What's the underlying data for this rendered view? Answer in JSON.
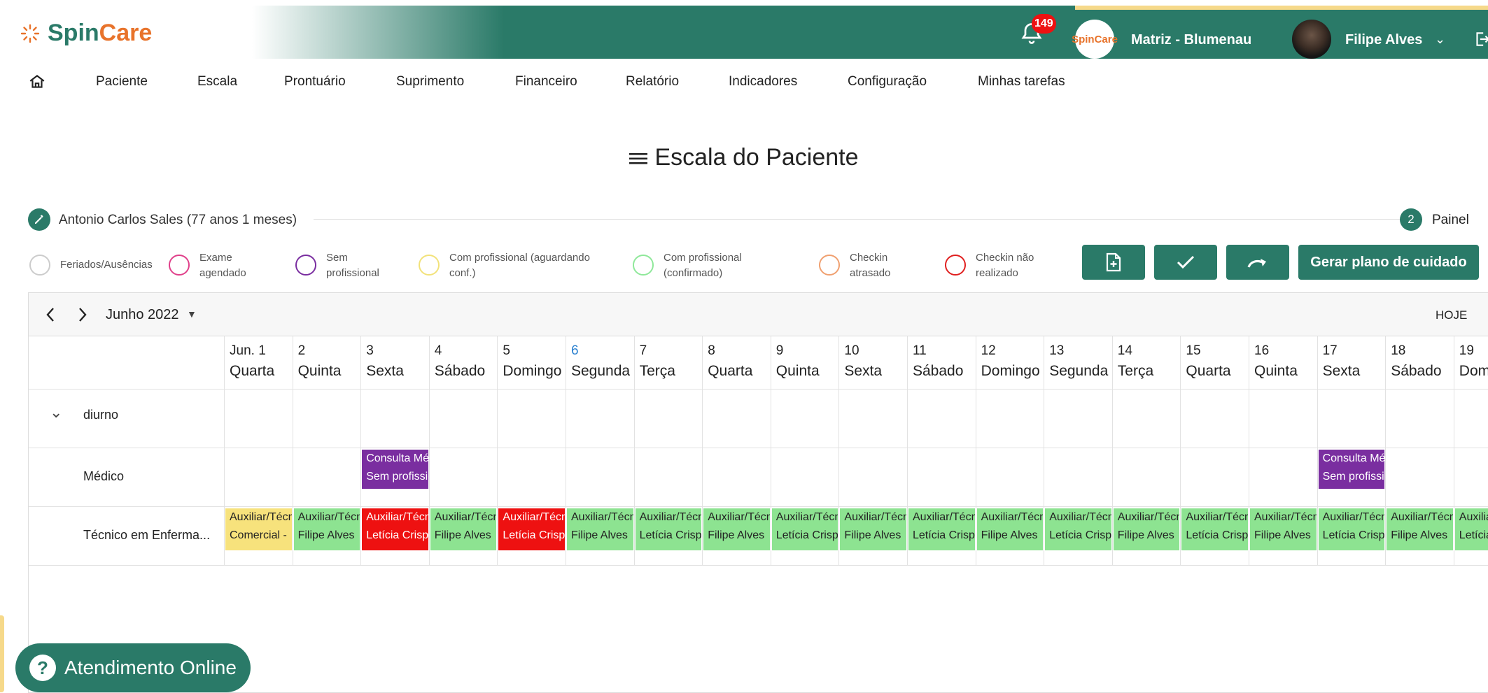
{
  "header": {
    "logo_spin": "Spin",
    "logo_care": "Care",
    "notification_count": "149",
    "branch_logo": "SpinCare",
    "branch": "Matriz - Blumenau",
    "user": "Filipe Alves",
    "brand_color": "#2a7a68",
    "accent_color": "#e8732b"
  },
  "menu": {
    "items": [
      "Paciente",
      "Escala",
      "Prontuário",
      "Suprimento",
      "Financeiro",
      "Relatório",
      "Indicadores",
      "Configuração",
      "Minhas tarefas"
    ]
  },
  "page": {
    "title": "Escala do Paciente",
    "patient": "Antonio Carlos Sales (77 anos 1 meses)",
    "step": "2",
    "step_label": "Painel"
  },
  "legend": [
    {
      "label": "Feriados/Ausências",
      "color": "#cccccc"
    },
    {
      "label": "Exame agendado",
      "color": "#e0408a"
    },
    {
      "label": "Sem profissional",
      "color": "#7a2ea0"
    },
    {
      "label": "Com profissional (aguardando conf.)",
      "color": "#f2e27a"
    },
    {
      "label": "Com profissional (confirmado)",
      "color": "#8fe89a"
    },
    {
      "label": "Checkin atrasado",
      "color": "#f0a070"
    },
    {
      "label": "Checkin não realizado",
      "color": "#e02020"
    }
  ],
  "actions": {
    "add_icon": "file-plus-icon",
    "confirm_icon": "check-icon",
    "redo_icon": "redo-icon",
    "care_plan": "Gerar plano de cuidado"
  },
  "calendar": {
    "month": "Junho 2022",
    "today": "HOJE",
    "today_day": "6",
    "days": [
      {
        "num": "Jun. 1",
        "name": "Quarta"
      },
      {
        "num": "2",
        "name": "Quinta"
      },
      {
        "num": "3",
        "name": "Sexta"
      },
      {
        "num": "4",
        "name": "Sábado"
      },
      {
        "num": "5",
        "name": "Domingo"
      },
      {
        "num": "6",
        "name": "Segunda"
      },
      {
        "num": "7",
        "name": "Terça"
      },
      {
        "num": "8",
        "name": "Quarta"
      },
      {
        "num": "9",
        "name": "Quinta"
      },
      {
        "num": "10",
        "name": "Sexta"
      },
      {
        "num": "11",
        "name": "Sábado"
      },
      {
        "num": "12",
        "name": "Domingo"
      },
      {
        "num": "13",
        "name": "Segunda"
      },
      {
        "num": "14",
        "name": "Terça"
      },
      {
        "num": "15",
        "name": "Quarta"
      },
      {
        "num": "16",
        "name": "Quinta"
      },
      {
        "num": "17",
        "name": "Sexta"
      },
      {
        "num": "18",
        "name": "Sábado"
      },
      {
        "num": "19",
        "name": "Domingo"
      }
    ],
    "group": "diurno",
    "rows": [
      {
        "label": "Médico",
        "events": [
          {
            "day": 2,
            "line1": "Consulta Médica",
            "line2": "Sem profissional",
            "status": "sem"
          },
          {
            "day": 16,
            "line1": "Consulta Médica",
            "line2": "Sem profissional",
            "status": "sem"
          }
        ]
      },
      {
        "label": "Técnico em Enferma...",
        "events": [
          {
            "day": 0,
            "line1": "Auxiliar/Técnico",
            "line2": "Comercial - ",
            "status": "aguardando"
          },
          {
            "day": 1,
            "line1": "Auxiliar/Técnico",
            "line2": "Filipe Alves",
            "status": "confirmado"
          },
          {
            "day": 2,
            "line1": "Auxiliar/Técnico",
            "line2": "Letícia Crispim",
            "status": "nao_realizado"
          },
          {
            "day": 3,
            "line1": "Auxiliar/Técnico",
            "line2": "Filipe Alves",
            "status": "confirmado"
          },
          {
            "day": 4,
            "line1": "Auxiliar/Técnico",
            "line2": "Letícia Crispim",
            "status": "nao_realizado"
          },
          {
            "day": 5,
            "line1": "Auxiliar/Técnico",
            "line2": "Filipe Alves",
            "status": "confirmado"
          },
          {
            "day": 6,
            "line1": "Auxiliar/Técnico",
            "line2": "Letícia Crispim",
            "status": "confirmado"
          },
          {
            "day": 7,
            "line1": "Auxiliar/Técnico",
            "line2": "Filipe Alves",
            "status": "confirmado"
          },
          {
            "day": 8,
            "line1": "Auxiliar/Técnico",
            "line2": "Letícia Crispim",
            "status": "confirmado"
          },
          {
            "day": 9,
            "line1": "Auxiliar/Técnico",
            "line2": "Filipe Alves",
            "status": "confirmado"
          },
          {
            "day": 10,
            "line1": "Auxiliar/Técnico",
            "line2": "Letícia Crispim",
            "status": "confirmado"
          },
          {
            "day": 11,
            "line1": "Auxiliar/Técnico",
            "line2": "Filipe Alves",
            "status": "confirmado"
          },
          {
            "day": 12,
            "line1": "Auxiliar/Técnico",
            "line2": "Letícia Crispim",
            "status": "confirmado"
          },
          {
            "day": 13,
            "line1": "Auxiliar/Técnico",
            "line2": "Filipe Alves",
            "status": "confirmado"
          },
          {
            "day": 14,
            "line1": "Auxiliar/Técnico",
            "line2": "Letícia Crispim",
            "status": "confirmado"
          },
          {
            "day": 15,
            "line1": "Auxiliar/Técnico",
            "line2": "Filipe Alves",
            "status": "confirmado"
          },
          {
            "day": 16,
            "line1": "Auxiliar/Técnico",
            "line2": "Letícia Crispim",
            "status": "confirmado"
          },
          {
            "day": 17,
            "line1": "Auxiliar/Técnico",
            "line2": "Filipe Alves",
            "status": "confirmado"
          },
          {
            "day": 18,
            "line1": "Auxiliar/Técnico",
            "line2": "Letícia Crispim",
            "status": "confirmado"
          }
        ]
      }
    ],
    "status_colors": {
      "sem": {
        "bg": "#7a2ea0",
        "fg": "#ffffff"
      },
      "aguardando": {
        "bg": "#f7e27c",
        "fg": "#222222"
      },
      "confirmado": {
        "bg": "#8de391",
        "fg": "#222222"
      },
      "nao_realizado": {
        "bg": "#ee1111",
        "fg": "#ffffff"
      }
    },
    "today_color": "#2a80d0"
  },
  "support": {
    "label": "Atendimento Online"
  }
}
